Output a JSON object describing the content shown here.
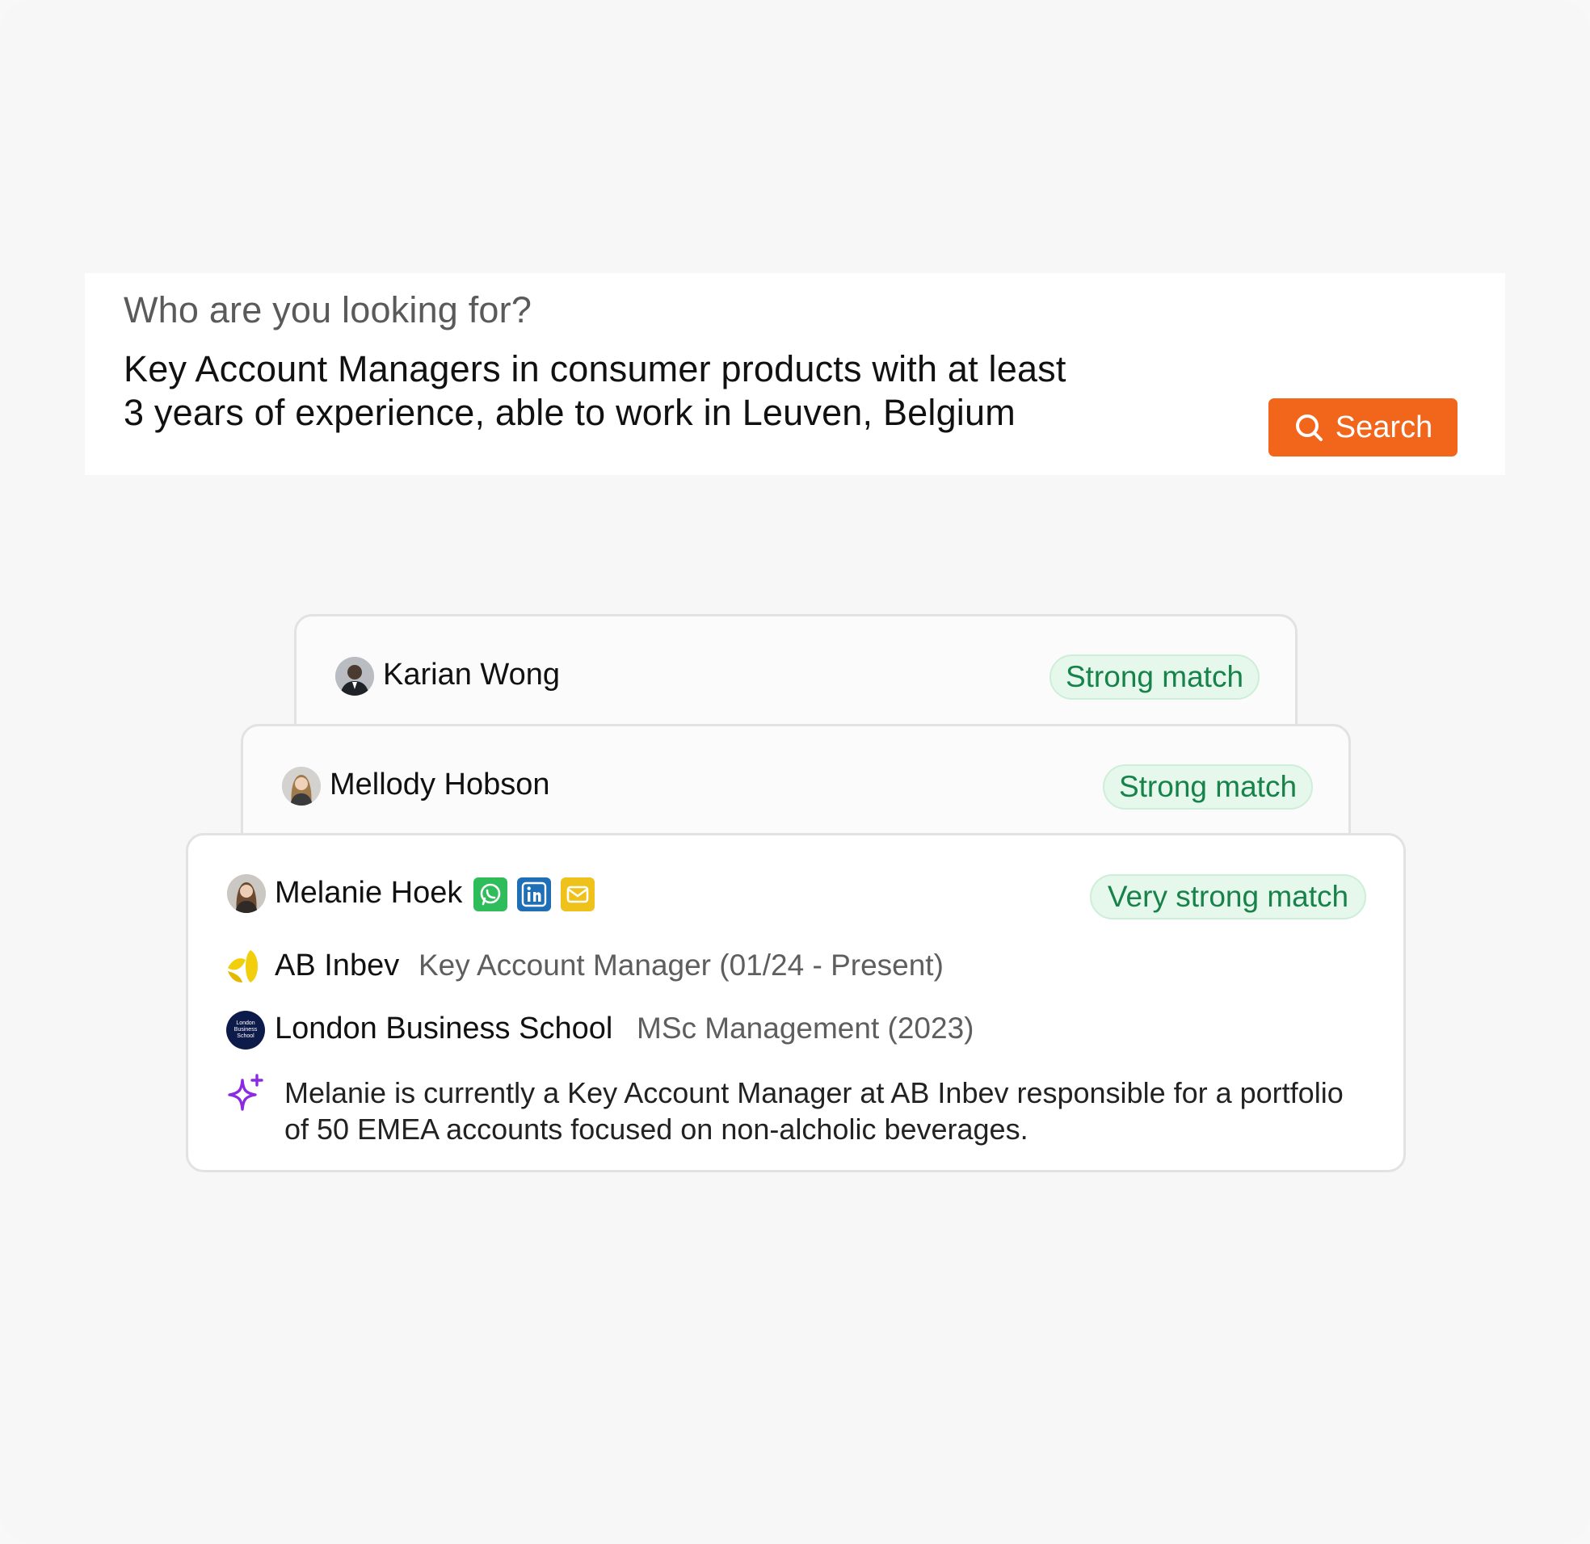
{
  "search": {
    "prompt": "Who are you looking for?",
    "query_line1": "Key Account Managers in consumer products with at least",
    "query_line2": "3 years of experience, able to work in Leuven, Belgium",
    "button_label": "Search"
  },
  "candidates": [
    {
      "name": "Karian Wong",
      "match": "Strong match"
    },
    {
      "name": "Mellody Hobson",
      "match": "Strong match"
    },
    {
      "name": "Melanie Hoek",
      "match": "Very strong match",
      "company": "AB Inbev",
      "company_role": "Key Account Manager (01/24 - Present)",
      "school": "London Business School",
      "school_logo_text": [
        "London",
        "Business",
        "School"
      ],
      "degree": "MSc Management (2023)",
      "summary": "Melanie is currently a Key Account Manager at AB Inbev responsible for a portfolio of 50 EMEA accounts focused on non-alcholic beverages.",
      "contacts": [
        "whatsapp-icon",
        "linkedin-icon",
        "email-icon"
      ]
    }
  ],
  "colors": {
    "accent": "#f2661b",
    "match_text": "#17824a",
    "match_bg": "#e6f8ec",
    "ai_sparkle": "#8a2be2"
  }
}
